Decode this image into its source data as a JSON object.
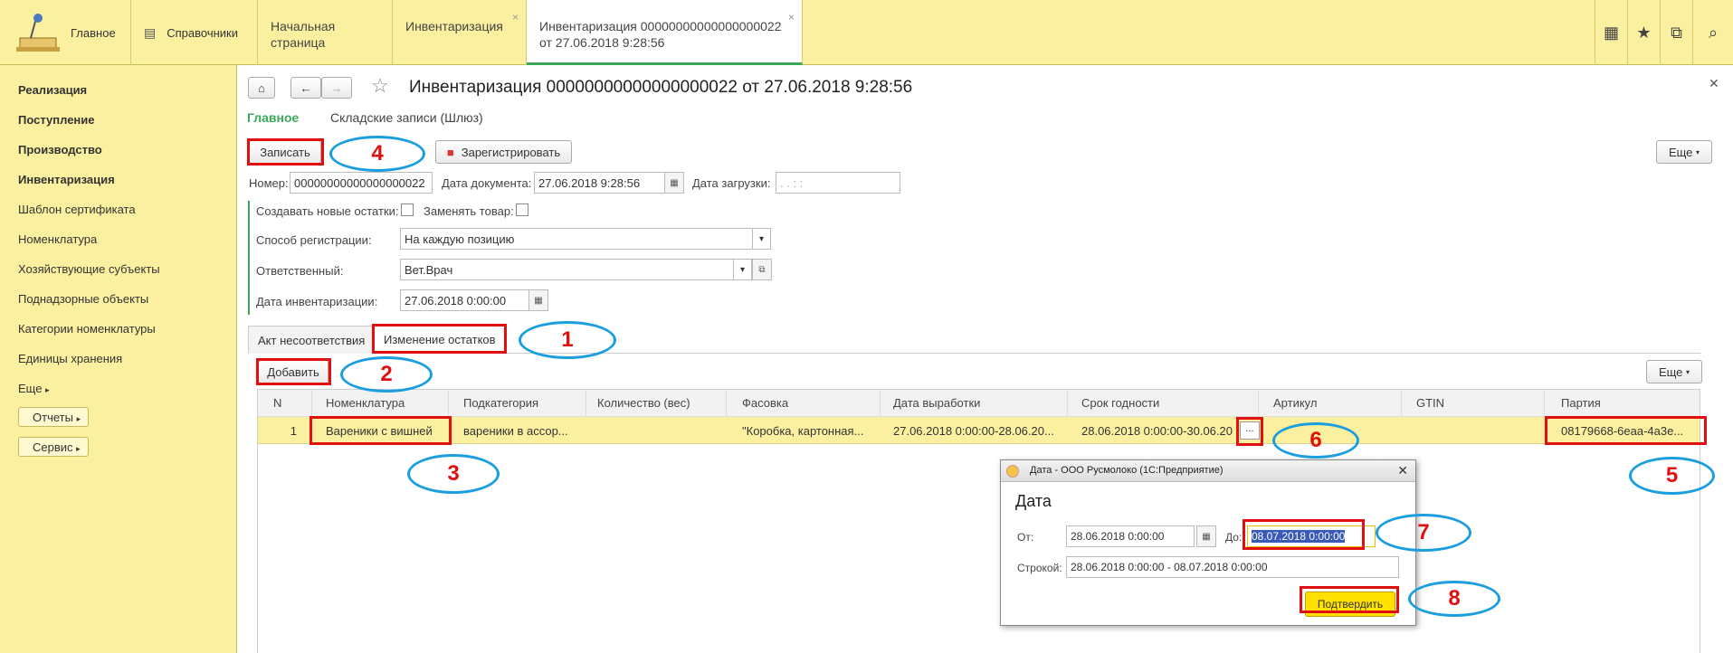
{
  "topbar": {
    "home_label": "Главное",
    "refs_label": "Справочники",
    "tabs": [
      {
        "label": "Начальная страница"
      },
      {
        "label": "Инвентаризация"
      },
      {
        "label": "Инвентаризация 00000000000000000022 от 27.06.2018 9:28:56"
      }
    ],
    "close_glyph": "×"
  },
  "sidebar": {
    "items": [
      "Реализация",
      "Поступление",
      "Производство",
      "Инвентаризация",
      "Шаблон сертификата",
      "Номенклатура",
      "Хозяйствующие субъекты",
      "Поднадзорные объекты",
      "Категории номенклатуры",
      "Единицы хранения",
      "Еще"
    ],
    "reports_label": "Отчеты",
    "service_label": "Сервис"
  },
  "form": {
    "title": "Инвентаризация 00000000000000000022 от 27.06.2018 9:28:56",
    "subnav": {
      "main": "Главное",
      "link": "Складские записи (Шлюз)"
    },
    "save_label": "Записать",
    "register_label": "Зарегистрировать",
    "more_label": "Еще",
    "number_label": "Номер:",
    "number_value": "00000000000000000022",
    "doc_date_label": "Дата документа:",
    "doc_date_value": "27.06.2018  9:28:56",
    "load_date_label": "Дата загрузки:",
    "load_date_value": " .  .      :  :",
    "create_label": "Создавать новые остатки:",
    "replace_label": "Заменять товар:",
    "method_label": "Способ регистрации:",
    "method_value": "На каждую позицию",
    "resp_label": "Ответственный:",
    "resp_value": "Вет.Врач",
    "inv_date_label": "Дата инвентаризации:",
    "inv_date_value": "27.06.2018  0:00:00"
  },
  "tabs": {
    "act": "Акт несоответствия",
    "change": "Изменение остатков"
  },
  "table": {
    "add_label": "Добавить",
    "more_label": "Еще",
    "columns": [
      "N",
      "Номенклатура",
      "Подкатегория",
      "Количество (вес)",
      "Фасовка",
      "Дата выработки",
      "Срок годности",
      "Артикул",
      "GTIN",
      "Партия"
    ],
    "row": [
      "1",
      "Вареники с вишней",
      "вареники в ассор...",
      "",
      "\"Коробка, картонная...",
      "27.06.2018 0:00:00-28.06.20...",
      "28.06.2018 0:00:00-30.06.20",
      "",
      "",
      "08179668-6eaa-4a3e..."
    ],
    "ellipsis": "..."
  },
  "dialog": {
    "window_title": "Дата - ООО Русмолоко  (1С:Предприятие)",
    "heading": "Дата",
    "from_label": "От:",
    "from_value": "28.06.2018  0:00:00",
    "to_label": "До:",
    "to_value": "08.07.2018  0:00:00",
    "string_label": "Строкой:",
    "string_value": "28.06.2018 0:00:00 - 08.07.2018 0:00:00",
    "confirm_label": "Подтвердить"
  },
  "annotations": [
    "1",
    "2",
    "3",
    "4",
    "5",
    "6",
    "7",
    "8"
  ],
  "colors": {
    "accent_yellow": "#fbf0a0",
    "green": "#3da75a",
    "red": "#e01010",
    "blue": "#1a9ee0"
  }
}
